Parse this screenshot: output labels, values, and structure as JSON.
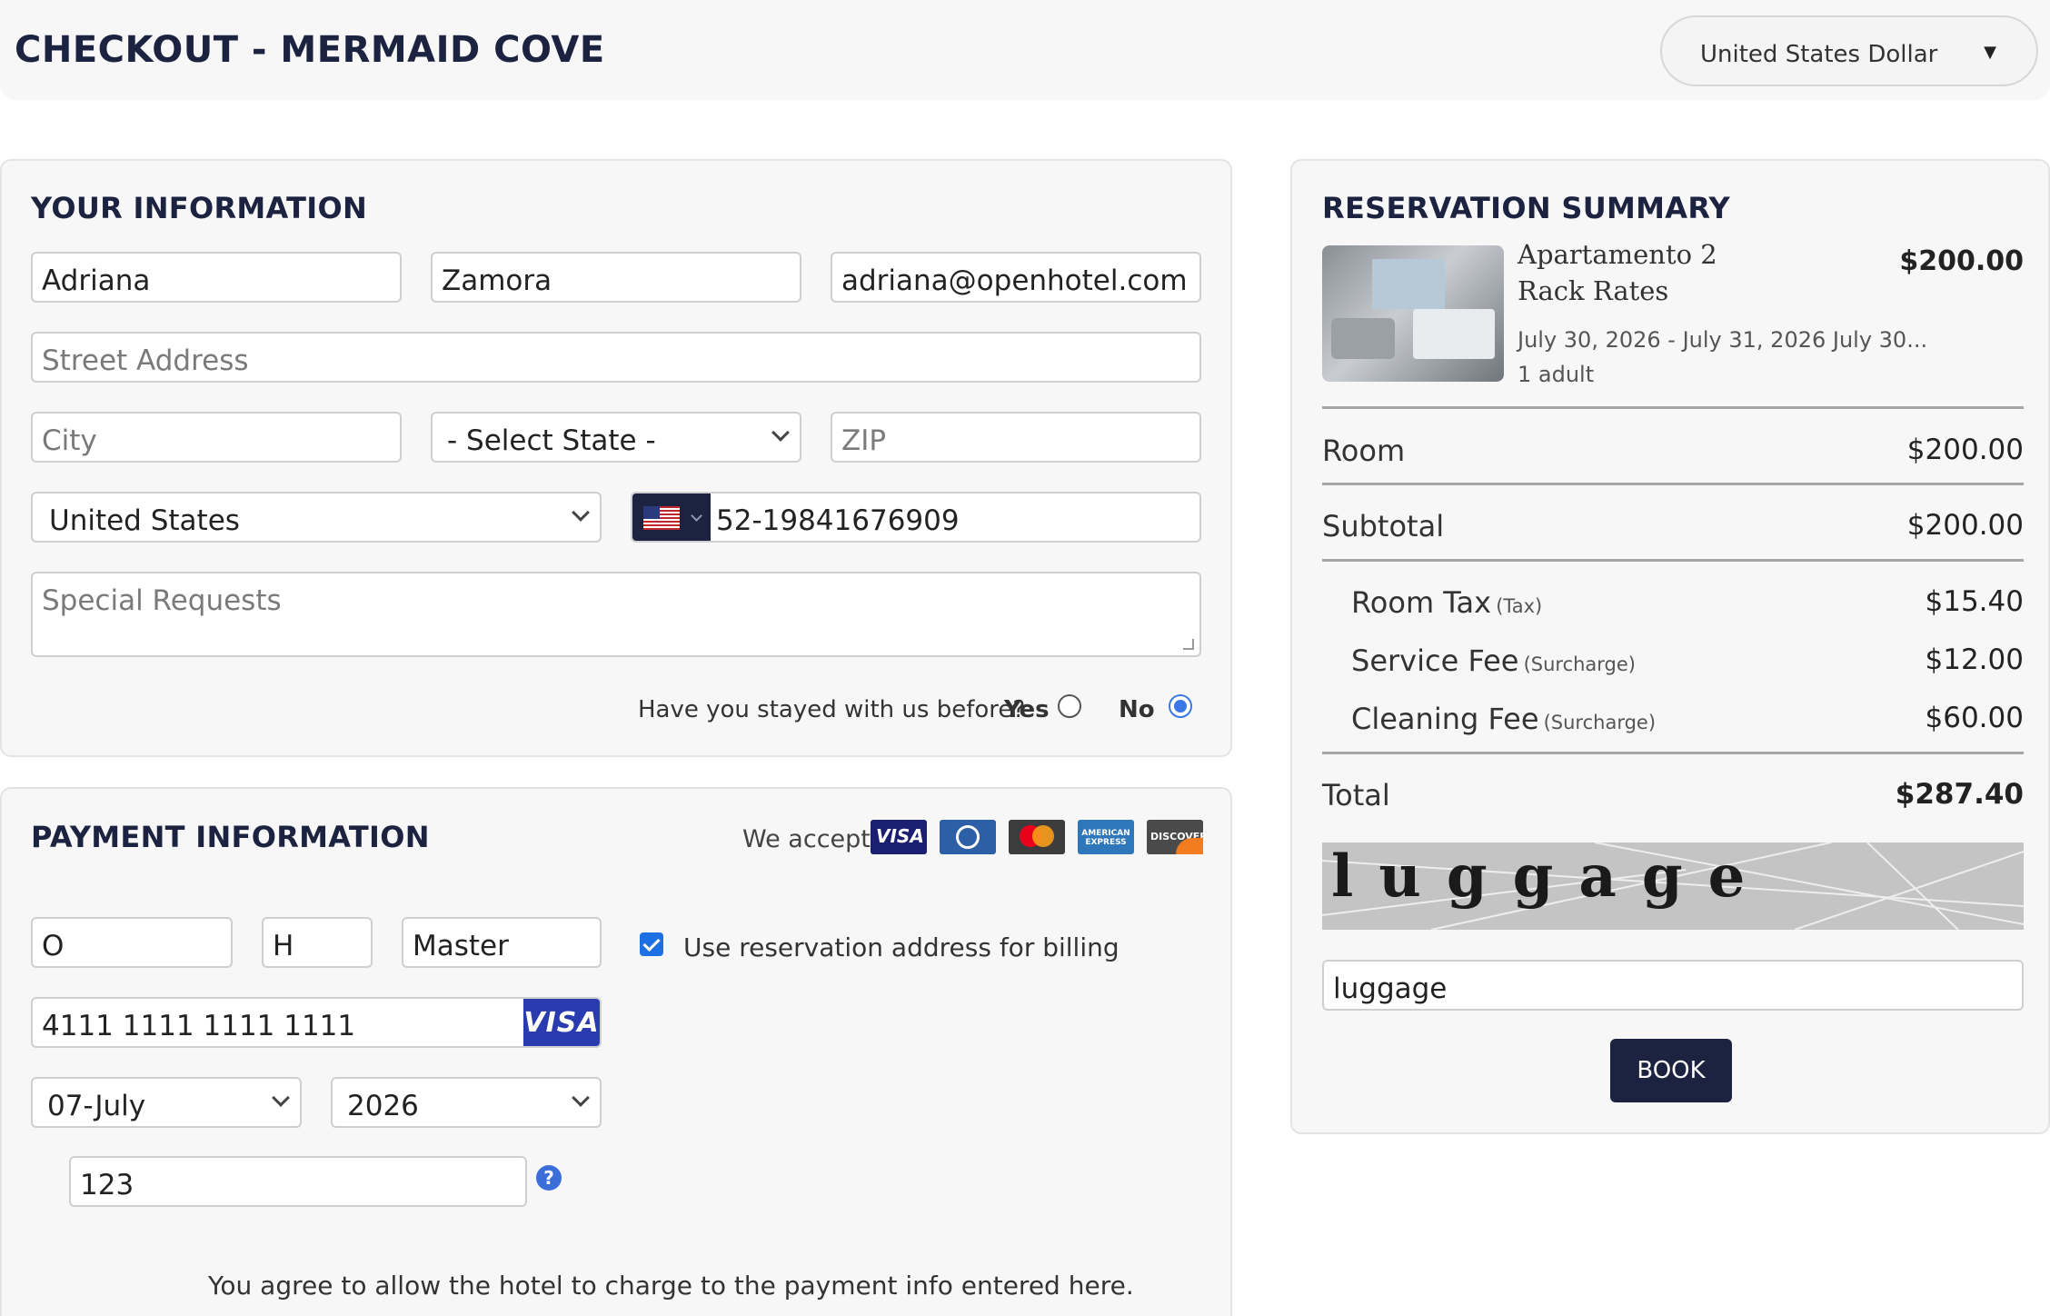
{
  "header": {
    "title": "CHECKOUT - MERMAID COVE",
    "currency": "United States Dollar",
    "currency_caret": "▼"
  },
  "your_info": {
    "title": "YOUR INFORMATION",
    "first_name": "Adriana",
    "last_name": "Zamora",
    "email": "adriana@openhotel.com",
    "street_placeholder": "Street Address",
    "city_placeholder": "City",
    "state": "- Select State -",
    "zip_placeholder": "ZIP",
    "country": "United States",
    "phone": "52-19841676909",
    "requests_placeholder": "Special Requests",
    "stayed_question": "Have you stayed with us before?",
    "yes": "Yes",
    "no": "No",
    "stayed_before_selected": "No"
  },
  "payment": {
    "title": "PAYMENT INFORMATION",
    "we_accept": "We accept:",
    "cards": [
      {
        "name": "VISA",
        "color": "#1a1f71"
      },
      {
        "name": "DINERS",
        "color": "#2d5fa6"
      },
      {
        "name": "MASTERCARD",
        "color": "#3c3c3c"
      },
      {
        "name": "AMERICAN EXPRESS",
        "color": "#2e77bb"
      },
      {
        "name": "DISCOVER",
        "color": "#4a4a4a"
      }
    ],
    "first_initial": "O",
    "middle_initial": "H",
    "card_name": "Master",
    "use_reservation_address": "Use reservation address for billing",
    "use_reservation_address_checked": true,
    "card_number": "4111 1111 1111 1111",
    "card_brand": "VISA",
    "exp_month": "07-July",
    "exp_year": "2026",
    "cvv": "123",
    "help": "?",
    "agreement": "You agree to allow the hotel to charge to the payment info entered here."
  },
  "reservation": {
    "title": "RESERVATION SUMMARY",
    "room_name": "Apartamento 2",
    "rate_name": "Rack Rates",
    "dates": "July 30, 2026 - July 31, 2026 July 30...",
    "guests": "1 adult",
    "item_price": "$200.00",
    "room_label": "Room",
    "room_amount": "$200.00",
    "subtotal_label": "Subtotal",
    "subtotal_amount": "$200.00",
    "fees": [
      {
        "label": "Room Tax",
        "type": "(Tax)",
        "amount": "$15.40"
      },
      {
        "label": "Service Fee",
        "type": "(Surcharge)",
        "amount": "$12.00"
      },
      {
        "label": "Cleaning Fee",
        "type": "(Surcharge)",
        "amount": "$60.00"
      }
    ],
    "total_label": "Total",
    "total_amount": "$287.40",
    "captcha_text": "luggage",
    "captcha_answer": "luggage",
    "book_label": "BOOK"
  }
}
